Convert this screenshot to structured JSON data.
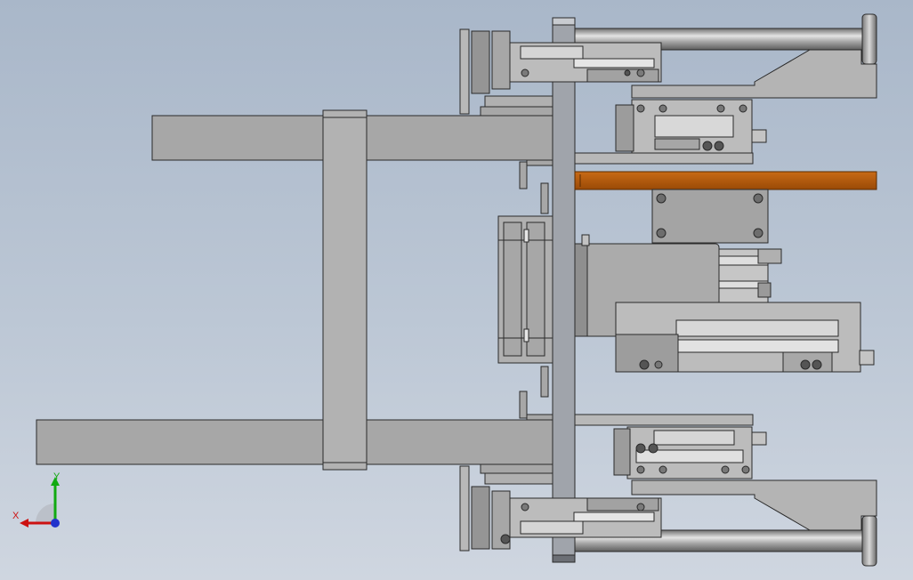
{
  "view": {
    "name": "top-view",
    "background": [
      "#a9b7c9",
      "#cfd6e0"
    ]
  },
  "triad": {
    "x_label": "X",
    "y_label": "Y",
    "x_color": "#cc1111",
    "y_color": "#11aa11",
    "origin_color": "#2233cc"
  },
  "model": {
    "part_fill": "#a7a7a7",
    "part_fill_light": "#bdbdbd",
    "part_fill_dark": "#8e8e8e",
    "edge_color": "#2a2a2a",
    "accent_bar_color": "#b35a0a",
    "rod_color": "#9a9a9a"
  }
}
